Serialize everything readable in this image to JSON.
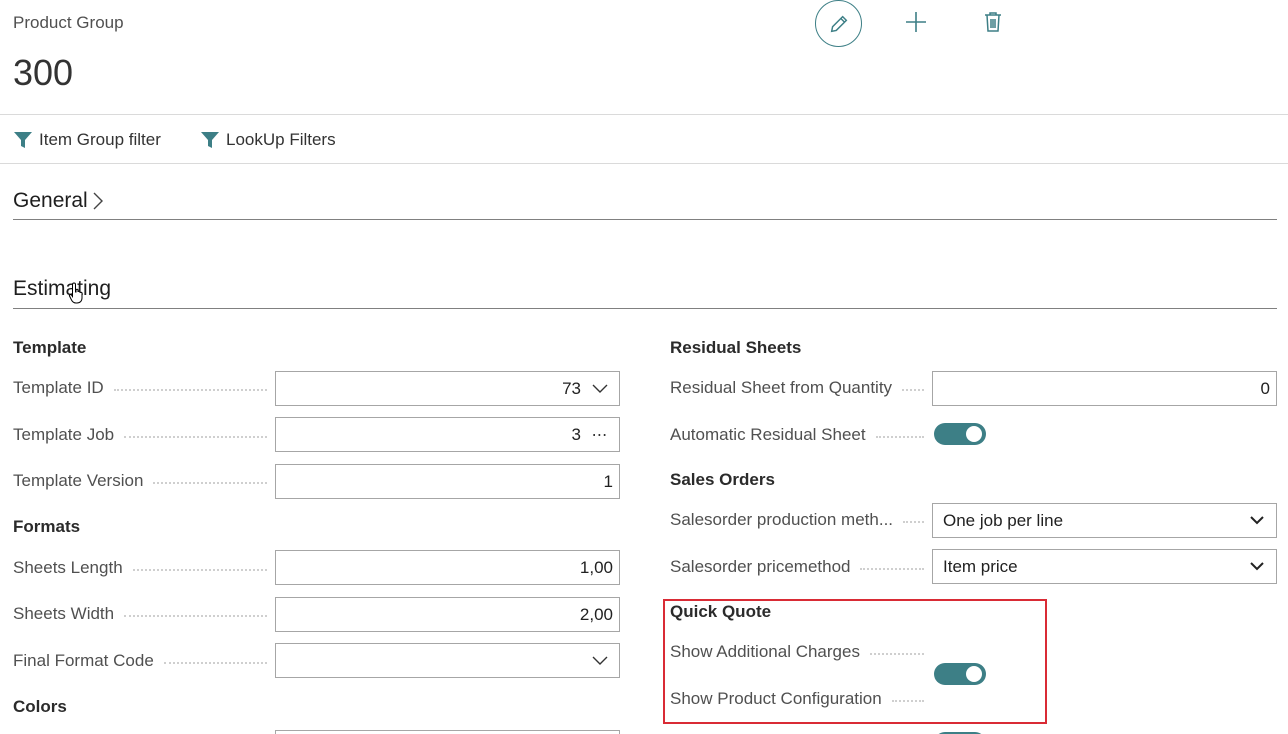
{
  "header": {
    "caption": "Product Group",
    "record_no": "300",
    "edit_icon": "pencil-icon",
    "new_icon": "plus-icon",
    "delete_icon": "trash-icon"
  },
  "actions": [
    {
      "label": "Item Group filter",
      "icon": "filter-icon"
    },
    {
      "label": "LookUp Filters",
      "icon": "filter-icon"
    }
  ],
  "sections": {
    "general": {
      "title": "General",
      "icon": "chevron-right-icon"
    },
    "estimating": {
      "title": "Estimating"
    }
  },
  "left": {
    "template": {
      "heading": "Template",
      "template_id": {
        "label": "Template ID",
        "value": "73",
        "icon": "chevron-down-icon"
      },
      "template_job": {
        "label": "Template Job",
        "value": "3",
        "icon": "ellipsis-icon"
      },
      "template_version": {
        "label": "Template Version",
        "value": "1"
      }
    },
    "formats": {
      "heading": "Formats",
      "sheets_length": {
        "label": "Sheets Length",
        "value": "1,00"
      },
      "sheets_width": {
        "label": "Sheets Width",
        "value": "2,00"
      },
      "final_format_code": {
        "label": "Final Format Code",
        "value": "",
        "icon": "chevron-down-icon"
      }
    },
    "colors": {
      "heading": "Colors"
    }
  },
  "right": {
    "residual": {
      "heading": "Residual Sheets",
      "from_quantity": {
        "label": "Residual Sheet from Quantity",
        "value": "0"
      },
      "automatic": {
        "label": "Automatic Residual Sheet",
        "on": true
      }
    },
    "sales_orders": {
      "heading": "Sales Orders",
      "production_method": {
        "label": "Salesorder production meth...",
        "value": "One job per line",
        "icon": "chevron-down-icon"
      },
      "pricemethod": {
        "label": "Salesorder pricemethod",
        "value": "Item price",
        "icon": "chevron-down-icon"
      }
    },
    "quick_quote": {
      "heading": "Quick Quote",
      "additional_charges": {
        "label": "Show Additional Charges",
        "on": true
      },
      "product_configuration": {
        "label": "Show Product Configuration",
        "on": true
      },
      "highlight_color": "#d92b35"
    }
  },
  "colors": {
    "accent": "#3d7f86",
    "highlight": "#d92b35"
  }
}
